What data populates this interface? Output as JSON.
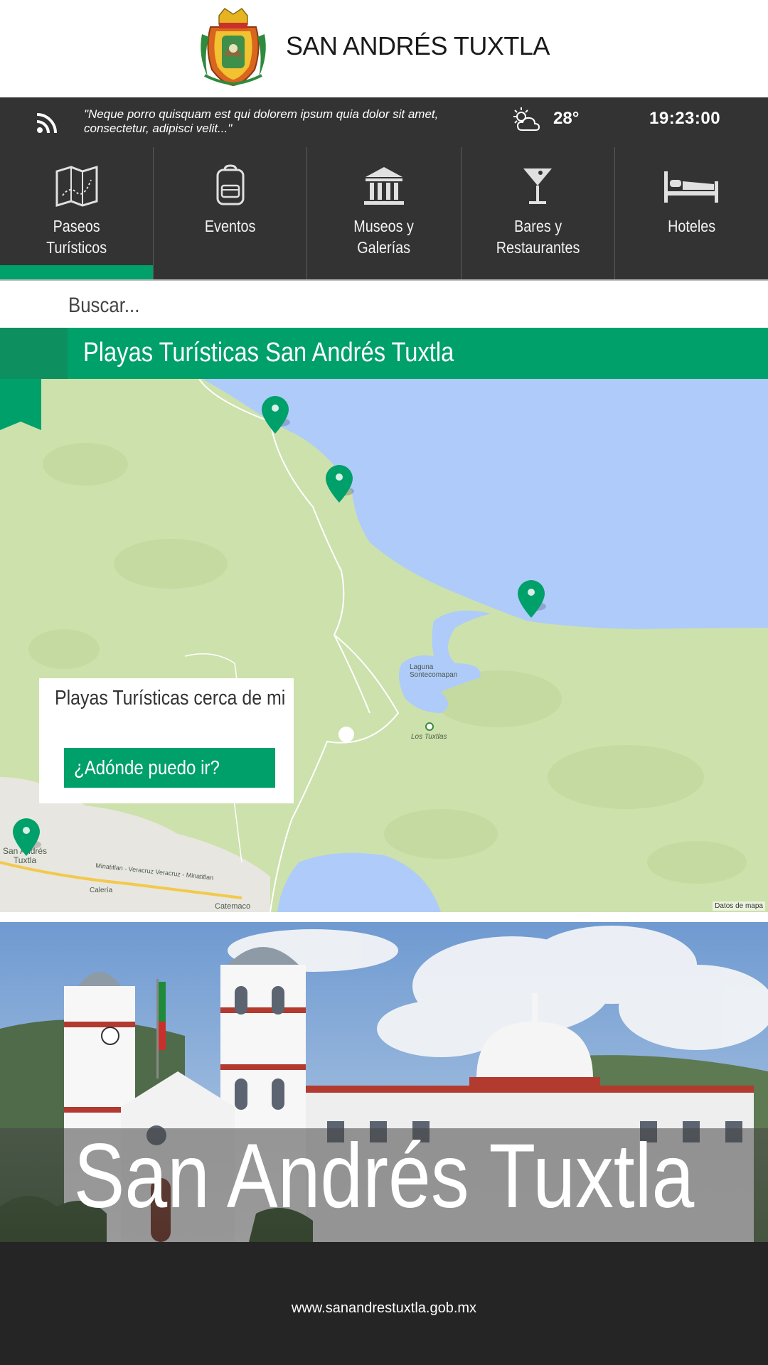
{
  "header": {
    "city_name": "SAN ANDRÉS TUXTLA",
    "crest_icon": "municipal-crest-logo"
  },
  "infobar": {
    "rss_icon": "rss-feed-icon",
    "quote": "\"Neque porro quisquam est qui dolorem ipsum quia dolor sit amet, consectetur, adipisci velit...\"",
    "weather_icon": "partly-cloudy-icon",
    "temperature": "28°",
    "time": "19:23:00"
  },
  "nav": {
    "items": [
      {
        "label_line1": "Paseos",
        "label_line2": "Turísticos",
        "icon": "folded-map-icon",
        "active": true
      },
      {
        "label_line1": "Eventos",
        "label_line2": "",
        "icon": "backpack-icon",
        "active": false
      },
      {
        "label_line1": "Museos y",
        "label_line2": "Galerías",
        "icon": "museum-icon",
        "active": false
      },
      {
        "label_line1": "Bares y",
        "label_line2": "Restaurantes",
        "icon": "cocktail-icon",
        "active": false
      },
      {
        "label_line1": "Hoteles",
        "label_line2": "",
        "icon": "bed-icon",
        "active": false
      }
    ],
    "active_color": "#00a06b"
  },
  "search": {
    "placeholder": "Buscar..."
  },
  "section": {
    "title": "Playas Turísticas San Andrés Tuxtla"
  },
  "map": {
    "labels": {
      "laguna_line1": "Laguna",
      "laguna_line2": "Sontecomapan",
      "los_tuxtlas": "Los Tuxtlas",
      "san_andres_line1": "San Andrés",
      "san_andres_line2": "Tuxtla",
      "road": "Minatitlan - Veracruz Veracruz - Minatitlan",
      "caleria": "Calería",
      "catemaco": "Catemaco"
    },
    "credit": "Datos de mapa",
    "pin_color": "#00a06b",
    "water_color": "#aecbfa",
    "land_color": "#cde1ac"
  },
  "nearby": {
    "title": "Playas Turísticas cerca de mi",
    "button_label": "¿Adónde puedo ir?"
  },
  "photo": {
    "title": "San Andrés Tuxtla"
  },
  "footer": {
    "url": "www.sanandrestuxtla.gob.mx"
  }
}
